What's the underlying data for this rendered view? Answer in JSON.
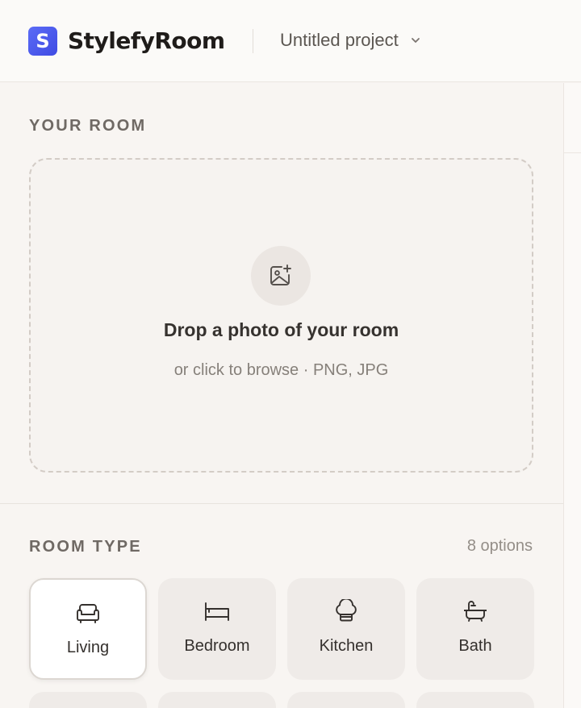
{
  "header": {
    "logo_letter": "S",
    "brand": "StylefyRoom",
    "project_name": "Untitled project",
    "accent_color": "#4f5df0"
  },
  "upload": {
    "section_label": "YOUR ROOM",
    "icon": "image-plus-icon",
    "title": "Drop a photo of your room",
    "subtitle": "or click to browse · PNG, JPG"
  },
  "room_type": {
    "section_label": "ROOM TYPE",
    "count_label": "8 options",
    "selected": "Living",
    "options": [
      {
        "label": "Living",
        "icon": "sofa-icon"
      },
      {
        "label": "Bedroom",
        "icon": "bed-icon"
      },
      {
        "label": "Kitchen",
        "icon": "chef-hat-icon"
      },
      {
        "label": "Bath",
        "icon": "bathtub-icon"
      }
    ]
  }
}
